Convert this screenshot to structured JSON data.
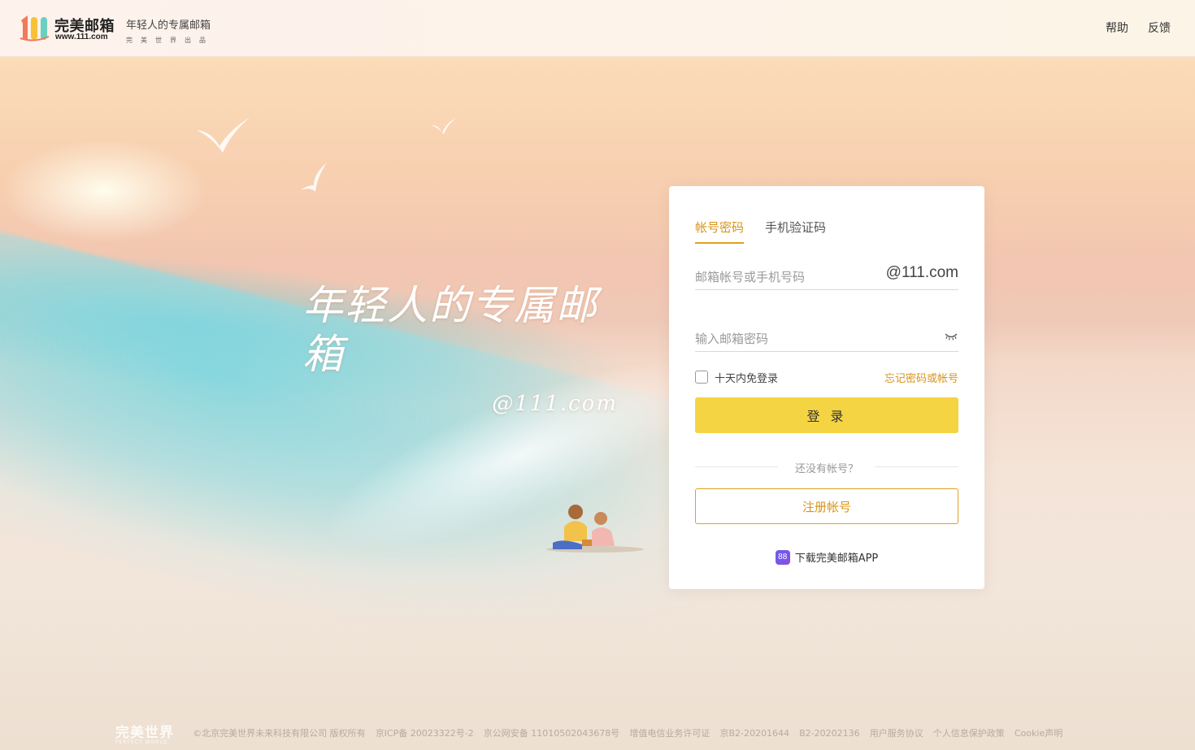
{
  "header": {
    "logo_name": "完美邮箱",
    "logo_domain": "www.111.com",
    "tagline": "年轻人的专属邮箱",
    "subtagline": "完美世界出品",
    "links": [
      "帮助",
      "反馈"
    ]
  },
  "hero": {
    "slogan": "年轻人的专属邮箱",
    "domain": "@111.com"
  },
  "login": {
    "tabs": [
      "帐号密码",
      "手机验证码"
    ],
    "active_tab": "帐号密码",
    "username_placeholder": "邮箱帐号或手机号码",
    "username_value": "",
    "domain_suffix": "@111.com",
    "password_placeholder": "输入邮箱密码",
    "password_value": "",
    "remember_label": "十天内免登录",
    "remember_checked": false,
    "forgot_label": "忘记密码或帐号",
    "login_button": "登 录",
    "no_account": "还没有帐号？",
    "register_button": "注册帐号",
    "app_icon_text": "88",
    "app_download": "下载完美邮箱APP"
  },
  "footer": {
    "brand": "完美世界",
    "brand_en": "PERFECT WORLD",
    "copyright": "©北京完美世界未来科技有限公司 版权所有",
    "icp": "京ICP备 20023322号-2",
    "police": "京公网安备 11010502043678号",
    "license": "增值电信业务许可证",
    "license_no1": "京B2-20201644",
    "license_no2": "B2-20202136",
    "links": [
      "用户服务协议",
      "个人信息保护政策",
      "Cookie声明"
    ]
  },
  "colors": {
    "accent": "#d89419",
    "login_button": "#f5d443",
    "icon_purple": "#6a5cf0"
  }
}
